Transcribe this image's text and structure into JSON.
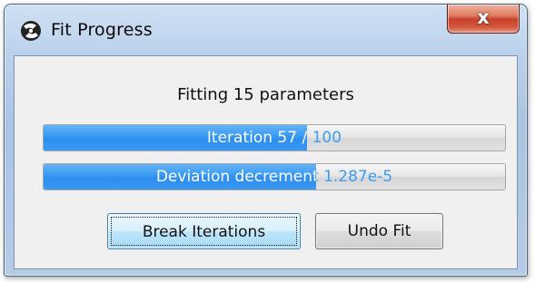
{
  "window": {
    "title": "Fit Progress",
    "close_label": "x"
  },
  "status": {
    "message": "Fitting 15 parameters"
  },
  "progress": [
    {
      "text": "Iteration 57 / 100",
      "fraction": 0.57
    },
    {
      "text": "Deviation decrement 1.287e-5",
      "fraction": 0.59
    }
  ],
  "buttons": {
    "break_label": "Break Iterations",
    "undo_label": "Undo Fit"
  },
  "colors": {
    "accent": "#3d9df2",
    "close": "#c8412a"
  }
}
